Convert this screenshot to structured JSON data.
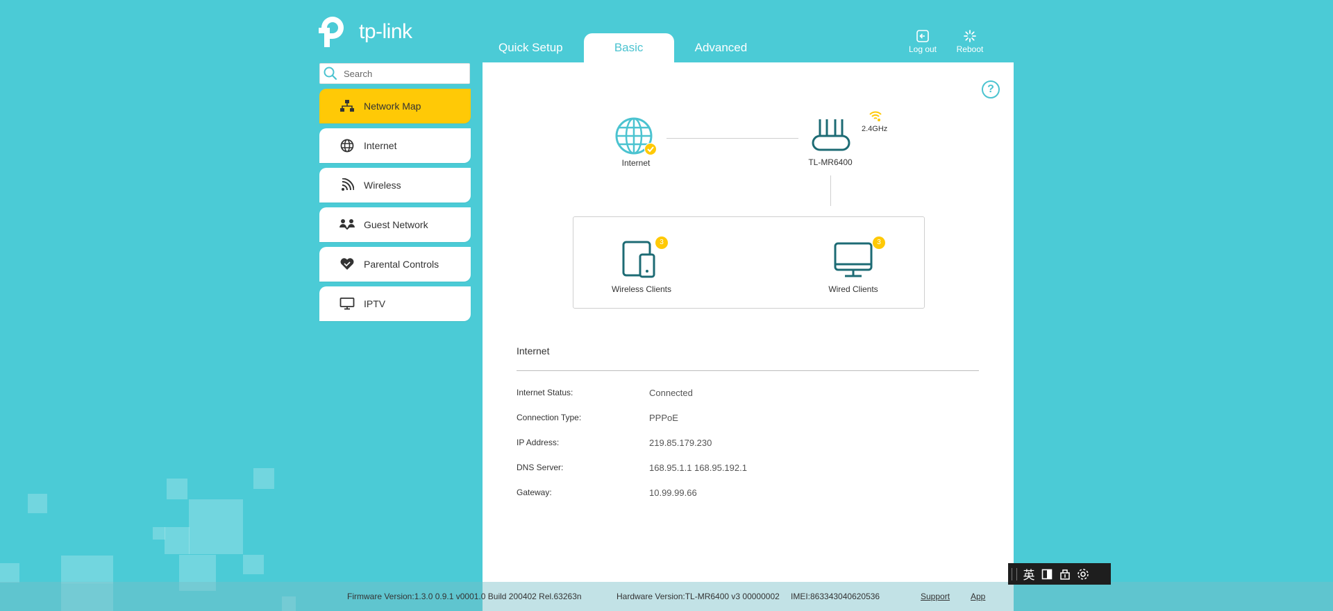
{
  "brand": {
    "logo_text": "tp-link"
  },
  "tabs": [
    {
      "label": "Quick Setup"
    },
    {
      "label": "Basic"
    },
    {
      "label": "Advanced"
    }
  ],
  "top_actions": {
    "logout_label": "Log out",
    "reboot_label": "Reboot"
  },
  "search": {
    "placeholder": "Search"
  },
  "sidebar": {
    "items": [
      {
        "label": "Network Map",
        "icon": "network-map-icon",
        "active": true
      },
      {
        "label": "Internet",
        "icon": "globe-icon",
        "active": false
      },
      {
        "label": "Wireless",
        "icon": "wifi-icon",
        "active": false
      },
      {
        "label": "Guest Network",
        "icon": "guest-icon",
        "active": false
      },
      {
        "label": "Parental Controls",
        "icon": "heart-icon",
        "active": false
      },
      {
        "label": "IPTV",
        "icon": "monitor-icon",
        "active": false
      }
    ]
  },
  "map": {
    "internet_label": "Internet",
    "router_label": "TL-MR6400",
    "band_label": "2.4GHz",
    "wireless_clients_label": "Wireless Clients",
    "wireless_clients_count": "3",
    "wired_clients_label": "Wired Clients",
    "wired_clients_count": "3"
  },
  "internet_info": {
    "title": "Internet",
    "rows": [
      {
        "key": "Internet Status:",
        "value": "Connected"
      },
      {
        "key": "Connection Type:",
        "value": "PPPoE"
      },
      {
        "key": "IP Address:",
        "value": "219.85.179.230"
      },
      {
        "key": "DNS Server:",
        "value": "168.95.1.1 168.95.192.1"
      },
      {
        "key": "Gateway:",
        "value": "10.99.99.66"
      }
    ]
  },
  "footer": {
    "firmware": "Firmware Version:1.3.0 0.9.1 v0001.0 Build 200402 Rel.63263n",
    "hardware": "Hardware Version:TL-MR6400 v3 00000002",
    "imei": "IMEI:863343040620536",
    "support_label": "Support",
    "app_label": "App"
  },
  "ime": {
    "lang_label": "英"
  },
  "colors": {
    "accent": "#4bc3d0",
    "background": "#4bcbd6",
    "highlight": "#ffc906"
  }
}
